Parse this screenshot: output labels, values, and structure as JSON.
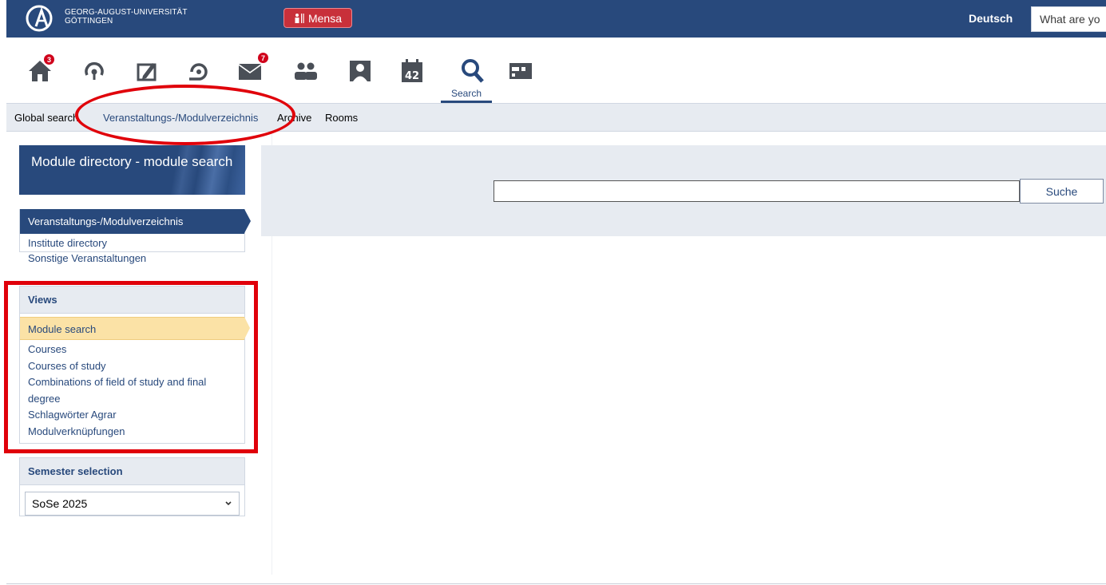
{
  "topbar": {
    "uni_line1": "GEORG-AUGUST-UNIVERSITÄT",
    "uni_line2": "GÖTTINGEN",
    "mensa_label": "Mensa",
    "language": "Deutsch",
    "quicksearch_placeholder": "What are yo"
  },
  "iconnav": {
    "home_badge": "3",
    "messages_badge": "7",
    "search_label": "Search"
  },
  "subnav": {
    "items": [
      "Global search",
      "Veranstaltungs-/Modulverzeichnis",
      "Archive",
      "Rooms"
    ]
  },
  "sidebar": {
    "title": "Module directory - module search",
    "directory_links": [
      "Veranstaltungs-/Modulverzeichnis",
      "Institute directory",
      "Sonstige Veranstaltungen"
    ],
    "views_heading": "Views",
    "views_links": [
      "Module search",
      "Courses",
      "Courses of study",
      "Combinations of field of study and final degree",
      "Schlagwörter Agrar",
      "Modulverknüpfungen"
    ],
    "semester_heading": "Semester selection",
    "semester_value": "SoSe 2025"
  },
  "main": {
    "search_value": "",
    "search_button": "Suche"
  },
  "colors": {
    "brand": "#28497c",
    "active_view": "#fbe2a6",
    "annotation": "#e0000a",
    "badge": "#d0021b"
  }
}
